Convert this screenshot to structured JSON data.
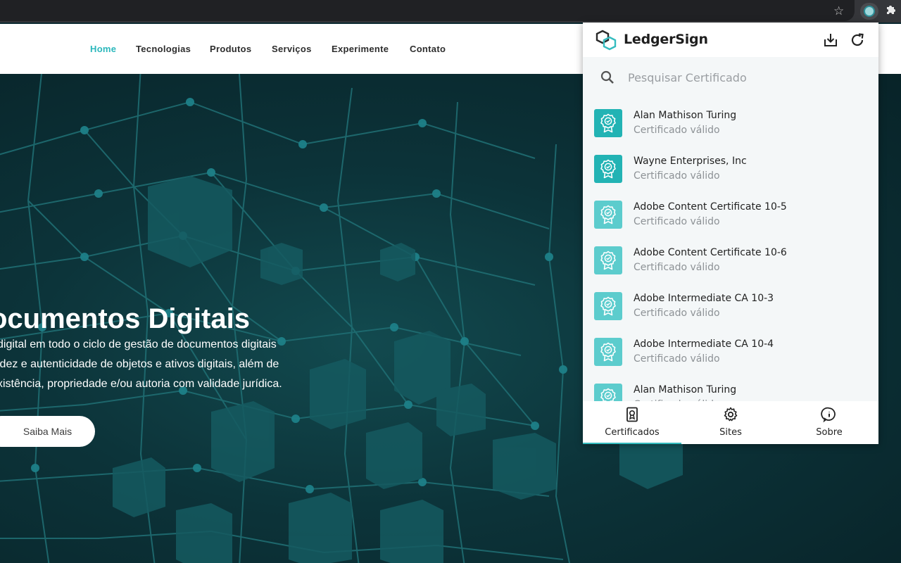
{
  "colors": {
    "accent": "#35bcbf",
    "badge_dark": "#22b3b4",
    "badge_light": "#5ccccd",
    "hero_bg": "#0c3339"
  },
  "browser": {
    "bookmark_icon": "star-icon",
    "extension_icon": "ledgersign-extension-icon",
    "extensions_menu_icon": "puzzle-icon"
  },
  "site": {
    "nav": [
      {
        "label": "Home",
        "active": true
      },
      {
        "label": "Tecnologias",
        "active": false
      },
      {
        "label": "Produtos",
        "active": false
      },
      {
        "label": "Serviços",
        "active": false
      },
      {
        "label": "Experimente",
        "active": false
      },
      {
        "label": "Contato",
        "active": false
      }
    ],
    "hero": {
      "title": "ocumentos Digitais",
      "lines": [
        " digital em todo o ciclo de gestão de documentos digitais",
        "idez e autenticidade de objetos e ativos digitais, além de",
        "xistência, propriedade e/ou autoria com validade jurídica."
      ],
      "cta": "Saiba Mais"
    }
  },
  "popup": {
    "brand": "LedgerSign",
    "header_icons": [
      "download-icon",
      "refresh-icon"
    ],
    "search": {
      "placeholder": "Pesquisar Certificado",
      "value": ""
    },
    "certificates": [
      {
        "name": "Alan Mathison Turing",
        "status": "Certificado válido",
        "badge": "dark"
      },
      {
        "name": "Wayne Enterprises, Inc",
        "status": "Certificado válido",
        "badge": "dark"
      },
      {
        "name": "Adobe Content Certificate 10-5",
        "status": "Certificado válido",
        "badge": "light"
      },
      {
        "name": "Adobe Content Certificate 10-6",
        "status": "Certificado válido",
        "badge": "light"
      },
      {
        "name": "Adobe Intermediate CA 10-3",
        "status": "Certificado válido",
        "badge": "light"
      },
      {
        "name": "Adobe Intermediate CA 10-4",
        "status": "Certificado válido",
        "badge": "light"
      },
      {
        "name": "Alan Mathison Turing",
        "status": "Certificado válido",
        "badge": "light"
      }
    ],
    "tabs": [
      {
        "label": "Certificados",
        "icon": "certificate-icon",
        "active": true
      },
      {
        "label": "Sites",
        "icon": "gear-icon",
        "active": false
      },
      {
        "label": "Sobre",
        "icon": "info-icon",
        "active": false
      }
    ]
  }
}
